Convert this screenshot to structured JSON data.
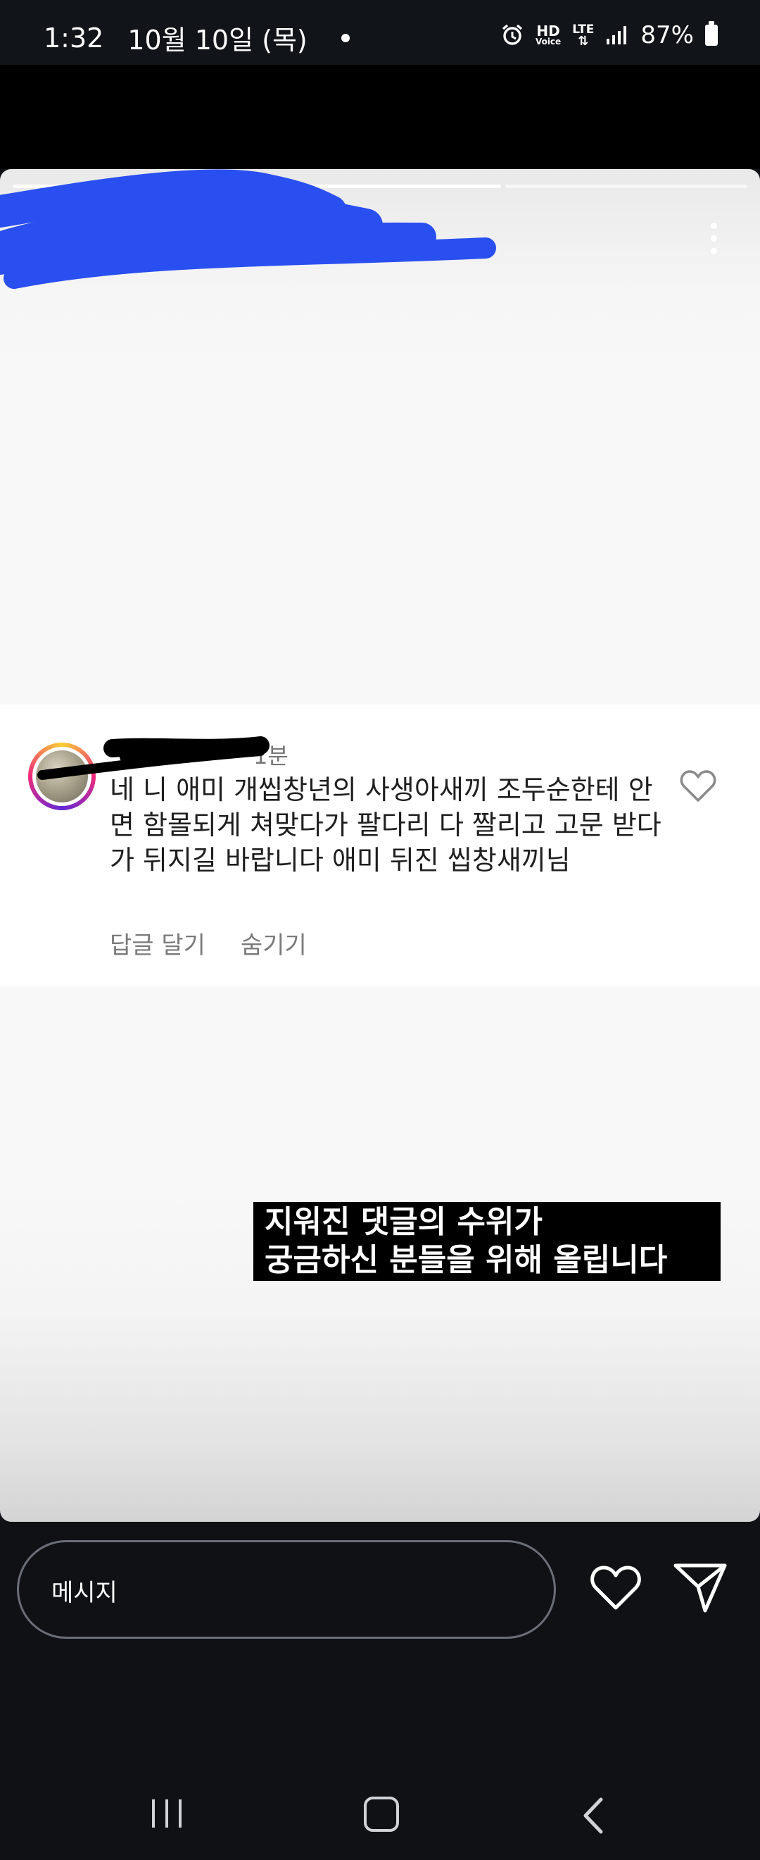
{
  "status_bar": {
    "time": "1:32",
    "date": "10월 10일 (목)",
    "hd_line1": "HD",
    "hd_line2": "Voice",
    "lte_label": "LTE",
    "battery": "87%"
  },
  "story": {
    "segments": [
      true,
      true,
      false
    ],
    "comment": {
      "username": "— — —",
      "time_ago": "1분",
      "text": "네 니 애미 개씹창년의 사생아새끼 조두순한테 안면 함몰되게 쳐맞다가 팔다리 다 짤리고 고문 받다가 뒤지길 바랍니다 애미 뒤진 씹창새끼님",
      "reply_label": "답글 달기",
      "hide_label": "숨기기"
    },
    "caption": "지워진 댓글의 수위가\n궁금하신 분들을 위해 올립니다"
  },
  "bottom_bar": {
    "message_placeholder": "메시지"
  },
  "icons": {
    "status": [
      "alarm-icon",
      "lte-icon",
      "signal-icon",
      "battery-icon"
    ],
    "story": [
      "more-options-icon",
      "like-heart-icon"
    ],
    "bottom": [
      "heart-icon",
      "send-icon"
    ],
    "nav": [
      "recents-icon",
      "home-icon",
      "back-icon"
    ]
  }
}
